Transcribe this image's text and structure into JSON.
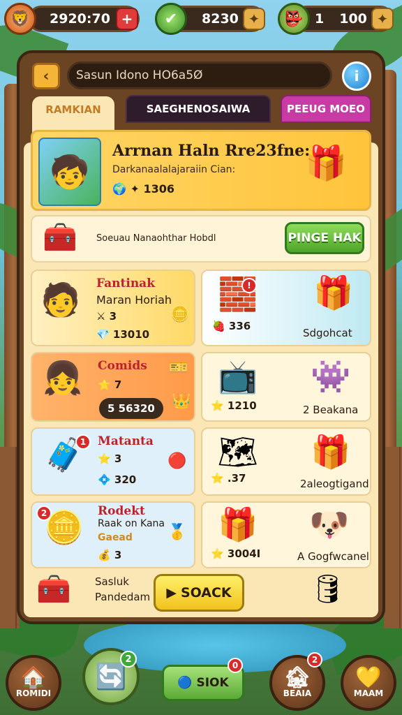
{
  "topbar": {
    "coins": "2920:70",
    "gems": "8230",
    "energy_a": "1",
    "energy_b": "100"
  },
  "header": {
    "search_text": "Sasun Idono HO6a5Ø",
    "tabs": [
      "RAMKIAN",
      "SAEGHENOSAIWA",
      "PEEUG MOEO"
    ]
  },
  "banner": {
    "title": "Arrnan Haln Rre23fne:",
    "subtitle": "Darkanaalalajaraiin Cian:",
    "count": "1306"
  },
  "strip": {
    "text": "Soeuau Nanaohthar Hobdl",
    "button": "PINGE HAK"
  },
  "tiles": [
    {
      "title": "Fantinak",
      "sub": "Maran Horiah",
      "line1": "3",
      "line2": "13010"
    },
    {
      "value": "336",
      "caption": "Sdgohcat"
    },
    {
      "title": "Comids",
      "line1": "7",
      "pill": "5 56320"
    },
    {
      "value": "1210",
      "caption": "2 Beakana"
    },
    {
      "title": "Matanta",
      "line1": "3",
      "line2": "320",
      "badge": "1"
    },
    {
      "value": ".37",
      "caption": "2aleogtigand"
    },
    {
      "title": "Rodekt",
      "sub": "Raak on Kana",
      "sub2": "Gaead",
      "line1": "3",
      "badge": "2"
    },
    {
      "value": "3004I",
      "caption": "A Gogfwcanel"
    }
  ],
  "bottom": {
    "label1": "Sasluk",
    "label2": "Pandedam",
    "button": "SOACK"
  },
  "nav": {
    "home": "ROMIDI",
    "shop": "SIOK",
    "shop_badge": "0",
    "center_badge": "2",
    "right1": "BEAIA",
    "right1_badge": "2",
    "right2": "MAAM"
  },
  "colors": {
    "panel": "#6b4424",
    "panel_inner": "#fbe7b6",
    "accent_green": "#4ea52b",
    "accent_gold": "#f1c21e",
    "tab_pink": "#c93ba4"
  }
}
